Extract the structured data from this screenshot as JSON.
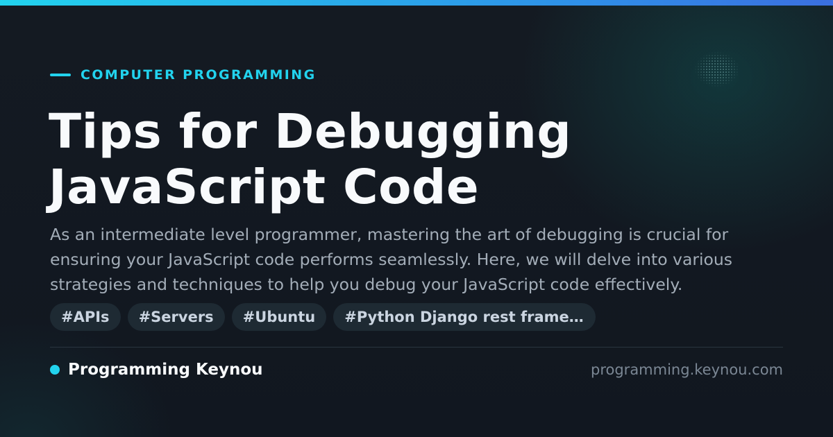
{
  "colors": {
    "accent": "#22d3ee",
    "accent_secondary": "#3b6fe0",
    "background": "#111820",
    "title": "#f8fafc",
    "description": "#a3adb8",
    "tag_background": "#1e2a33",
    "tag_text": "#cbd5e1",
    "domain": "#7b8794"
  },
  "category": "COMPUTER PROGRAMMING",
  "title": "Tips for Debugging JavaScript Code",
  "description": "As an intermediate level programmer, mastering the art of debugging is crucial for ensuring your JavaScript code performs seamlessly. Here, we will delve into various strategies and techniques to help you debug your JavaScript code effectively.",
  "tags": [
    "#APIs",
    "#Servers",
    "#Ubuntu",
    "#Python Django rest framework"
  ],
  "brand": {
    "name": "Programming Keynou",
    "icon": "dot-icon"
  },
  "domain": "programming.keynou.com"
}
